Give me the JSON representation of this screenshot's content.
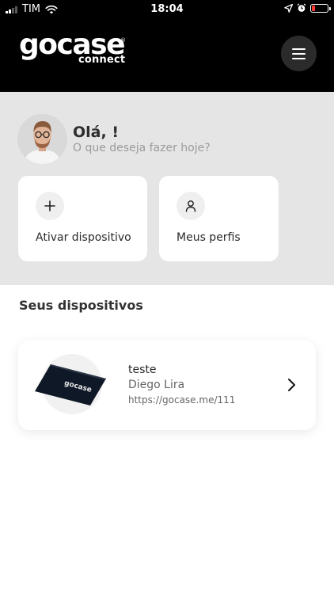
{
  "status_bar": {
    "carrier": "TIM",
    "time": "18:04"
  },
  "header": {
    "logo_main": "gocase",
    "logo_registered": "®",
    "logo_sub": "connect",
    "menu_icon": "hamburger-menu-icon"
  },
  "welcome": {
    "title": "Olá, !",
    "subtitle": "O que deseja fazer hoje?",
    "actions": [
      {
        "icon": "plus-icon",
        "label": "Ativar dispositivo"
      },
      {
        "icon": "user-icon",
        "label": "Meus perfis"
      }
    ]
  },
  "devices": {
    "title": "Seus dispositivos",
    "items": [
      {
        "name": "teste",
        "owner": "Diego Lira",
        "url": "https://gocase.me/111",
        "card_print": "gocase"
      }
    ]
  },
  "colors": {
    "header_bg": "#000000",
    "welcome_bg": "#e5e5e5",
    "battery_low": "#ff3b30",
    "card_bg": "#ffffff"
  }
}
